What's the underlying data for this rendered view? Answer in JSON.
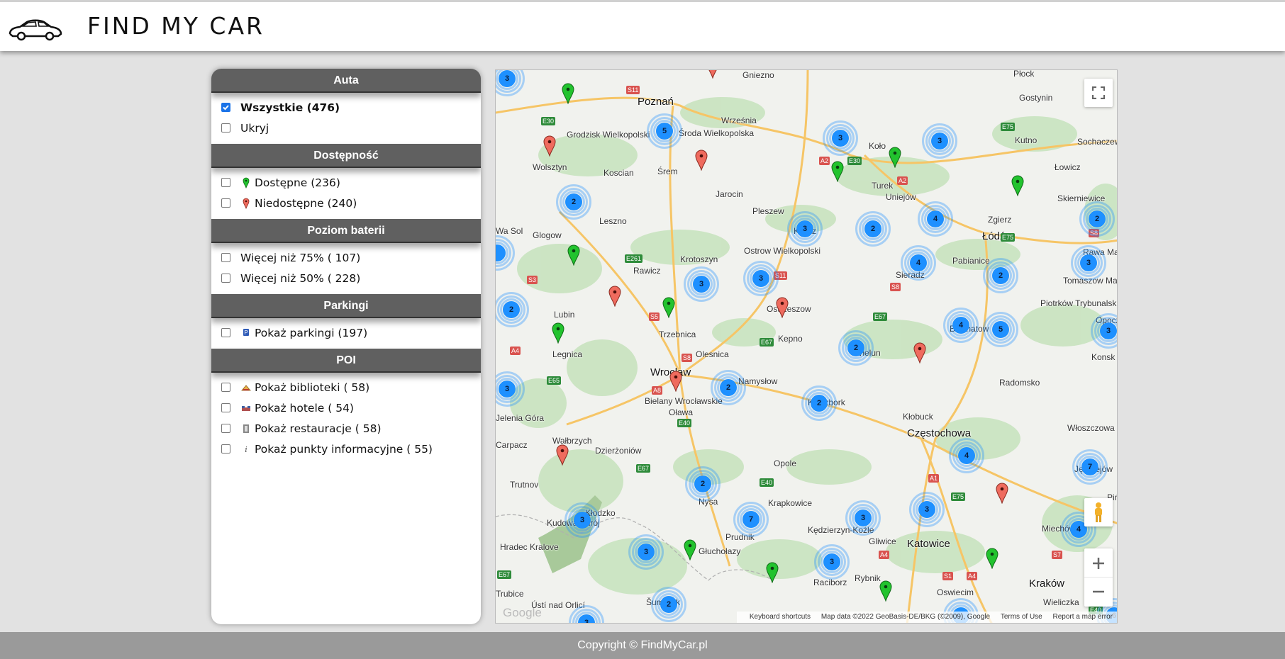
{
  "app": {
    "brand": "FIND MY CAR"
  },
  "sections": {
    "auta": {
      "title": "Auta",
      "items": [
        {
          "label": "Wszystkie (476)",
          "checked": true
        },
        {
          "label": "Ukryj",
          "checked": false
        }
      ]
    },
    "dostepnosc": {
      "title": "Dostępność",
      "items": [
        {
          "label": "Dostępne (236)",
          "icon": "green-pin-icon"
        },
        {
          "label": "Niedostępne (240)",
          "icon": "red-pin-icon"
        }
      ]
    },
    "bateria": {
      "title": "Poziom baterii",
      "items": [
        {
          "label": "Więcej niż 75% ( 107)"
        },
        {
          "label": "Więcej niż 50% ( 228)"
        }
      ]
    },
    "parkingi": {
      "title": "Parkingi",
      "items": [
        {
          "label": "Pokaż parkingi (197)",
          "icon": "parking-icon"
        }
      ]
    },
    "poi": {
      "title": "POI",
      "items": [
        {
          "label": "Pokaż biblioteki ( 58)",
          "icon": "library-icon"
        },
        {
          "label": "Pokaż hotele ( 54)",
          "icon": "hotel-icon"
        },
        {
          "label": "Pokaż restauracje ( 58)",
          "icon": "restaurant-icon"
        },
        {
          "label": "Pokaż punkty informacyjne ( 55)",
          "icon": "info-icon"
        }
      ]
    }
  },
  "map": {
    "cities": [
      "Gniezno",
      "Płock",
      "Poznań",
      "Gostynin",
      "Września",
      "Grodzisk Wielkopolski",
      "Środa Wielkopolska",
      "Kutno",
      "Sochaczew",
      "Wolsztyn",
      "Koscian",
      "Śrem",
      "Koło",
      "Łowicz",
      "Turek",
      "Uniejów",
      "Skierniewice",
      "Jarocin",
      "Leszno",
      "Zgierz",
      "Łódź",
      "Pleszew",
      "Kalisz",
      "Rawa Mazowiecka",
      "Wa Sol",
      "Glogow",
      "Krotoszyn",
      "Ostrow Wielkopolski",
      "Pabianice",
      "Sieradz",
      "Rawicz",
      "Tomaszow Mazowiecki",
      "Ostrzeszow",
      "Piotrków Trybunalski",
      "Lubin",
      "Opoczno",
      "Trzebnica",
      "Kepno",
      "Belchatow",
      "Legnica",
      "Olesnica",
      "Wielun",
      "Konsk",
      "Wrocław",
      "Namysłow",
      "Radomsko",
      "Kluczbork",
      "Bielany Wrocławskie",
      "Oława",
      "Kłobuck",
      "Częstochowa",
      "Włoszczowa",
      "Wałbrzych",
      "Dzierżoniów",
      "Opole",
      "Jędrzejów",
      "Trutnov",
      "Nysa",
      "Krapkowice",
      "Kłodzko",
      "Kudowa-Zdrój",
      "Kędzierzyn-Koźle",
      "Prudnik",
      "Gliwice",
      "Katowice",
      "Hradec Kralove",
      "Głuchołazy",
      "Rybnik",
      "Raciborz",
      "Oswiecim",
      "Kraków",
      "Wieliczka",
      "Ústí nad Orlicí",
      "Šumperk",
      "Miechów",
      "Pińczów",
      "Jelenia Góra",
      "Carpacz",
      "Trubice"
    ],
    "attribution": {
      "shortcuts": "Keyboard shortcuts",
      "data": "Map data ©2022 GeoBasis-DE/BKG (©2009), Google",
      "terms": "Terms of Use",
      "report": "Report a map error"
    },
    "watermark": "Google"
  },
  "footer": {
    "copyright": "Copyright © FindMyCar.pl"
  }
}
